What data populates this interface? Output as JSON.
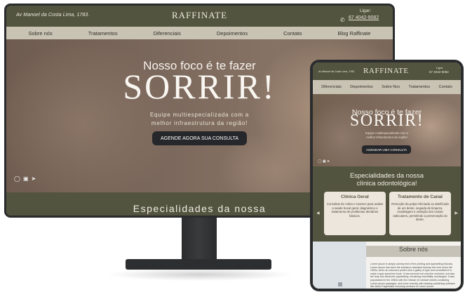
{
  "header": {
    "address": "Av Manoel da Costa Lima, 1783.",
    "logo": "RAFFINATE",
    "call_label": "Ligar:",
    "phone": "67 4042-9082",
    "phone_icon": "phone-icon"
  },
  "desktop_nav": [
    "Sobre nós",
    "Tratamentos",
    "Diferenciais",
    "Depoimentos",
    "Contato",
    "Blog Raffinate"
  ],
  "hero": {
    "headline": "Nosso foco é te fazer",
    "big_word": "SORRIR!",
    "subtitle_line1": "Equipe multiespecializada com a",
    "subtitle_line2": "melhor infraestrutura da região!",
    "cta": "AGENDE AGORA SUA CONSULTA",
    "social_icons": [
      "whatsapp-icon",
      "instagram-icon",
      "location-icon"
    ]
  },
  "specialties": {
    "desktop_title": "Especialidades da nossa",
    "title_line1": "Especialidades da nossa",
    "title_line2": "clínica odontológica!",
    "cards": [
      {
        "title": "Clínica Geral",
        "text": "Consultas de rotina e exames para avaliar a saúde bucal geral, diagnóstico e tratamento de problemas dentários básicos."
      },
      {
        "title": "Tratamento de Canal",
        "text": "Remoção da polpa infectada ou danificada de um dente, seguida de limpeza, modelagem e vedação dos canais radiculares, permitindo a preservação do dente."
      }
    ]
  },
  "tablet": {
    "address": "Av Manoel da Costa Lima, 1783.",
    "call_label": "Ligar:",
    "phone": "67 4042-9082",
    "nav": [
      "Diferenciais",
      "Depoimentos",
      "Sobre Nos",
      "Tratamentos",
      "Contato"
    ],
    "cta": "AGENDAR UMA CONSULTA"
  },
  "about": {
    "title": "Sobre nós",
    "text": "Lorem Ipsum is simply dummy text of the printing and typesetting industry. Lorem Ipsum has been the industry's standard dummy text ever since the 1500s, when an unknown printer took a galley of type and scrambled it to make a type specimen book. It has survived not only five centuries, but also the leap into electronic typesetting, remaining essentially unchanged. It was popularised in the 1960s with the release of Letraset sheets containing Lorem Ipsum passages, and more recently with desktop publishing software like Aldus PageMaker including versions of Lorem Ipsum.",
    "image_icon": "image-placeholder-icon"
  },
  "colors": {
    "olive": "#52543f",
    "nav_beige": "#c9c3b4",
    "card_bg": "#ece6dc",
    "cta_dark": "#26272a",
    "bezel": "#2b2c2e"
  }
}
